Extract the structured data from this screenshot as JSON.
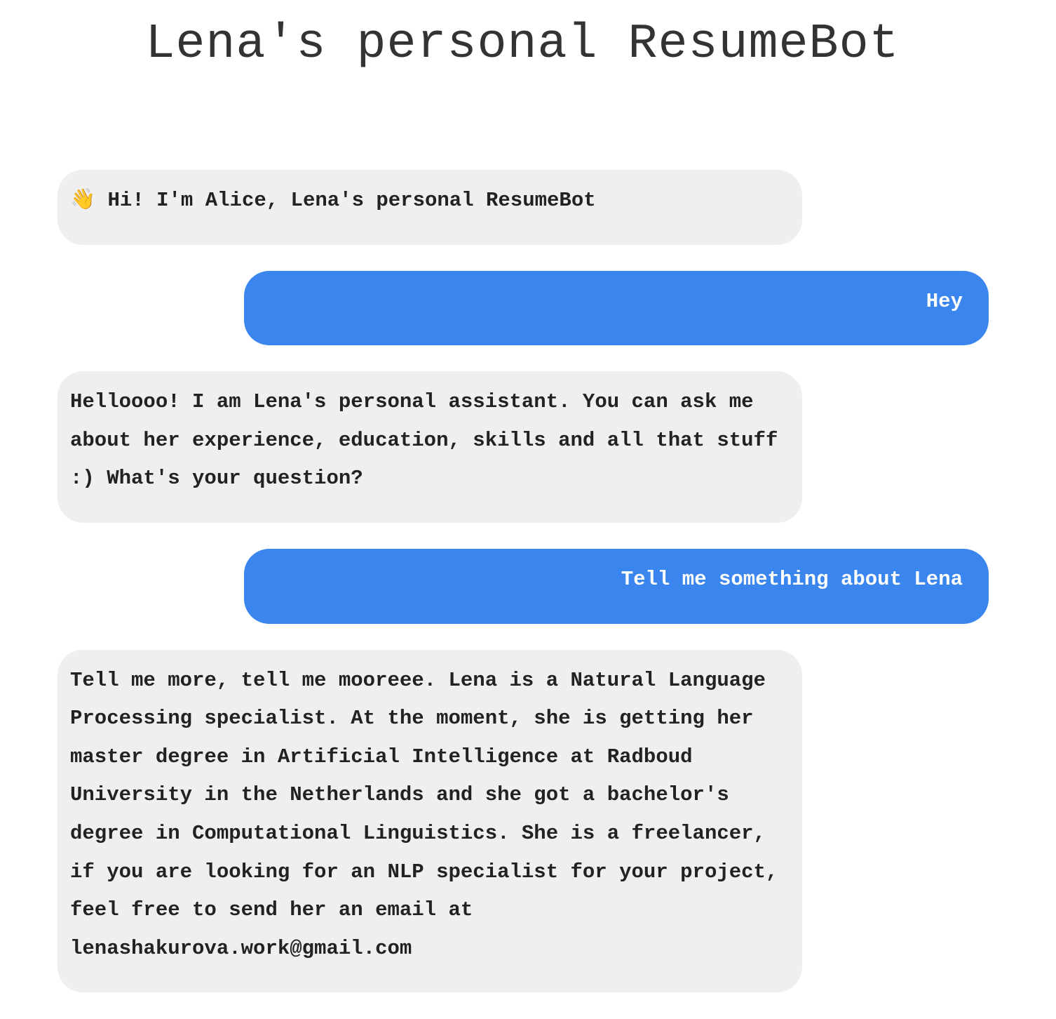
{
  "header": {
    "title": "Lena's personal ResumeBot"
  },
  "conversation": {
    "messages": [
      {
        "role": "bot",
        "icon": "waving-hand",
        "icon_glyph": "👋",
        "text": " Hi! I'm Alice, Lena's personal ResumeBot"
      },
      {
        "role": "user",
        "text": "Hey"
      },
      {
        "role": "bot",
        "text": " Helloooo! I am Lena's personal assistant. You can ask me about her experience, education, skills and all that stuff :) What's your question?"
      },
      {
        "role": "user",
        "text": "Tell me something about Lena"
      },
      {
        "role": "bot",
        "text": " Tell me more, tell me mooreee. Lena is a Natural Language Processing specialist. At the moment, she is getting her master degree in Artificial Intelligence at Radboud University in the Netherlands and she got a bachelor's degree in Computational Linguistics. She is a freelancer, if you are looking for an NLP specialist for your project, feel free to send her an email at lenashakurova.work@gmail.com"
      }
    ]
  },
  "colors": {
    "bot_bubble": "#efefef",
    "user_bubble": "#3a86ee",
    "title_text": "#333333"
  }
}
